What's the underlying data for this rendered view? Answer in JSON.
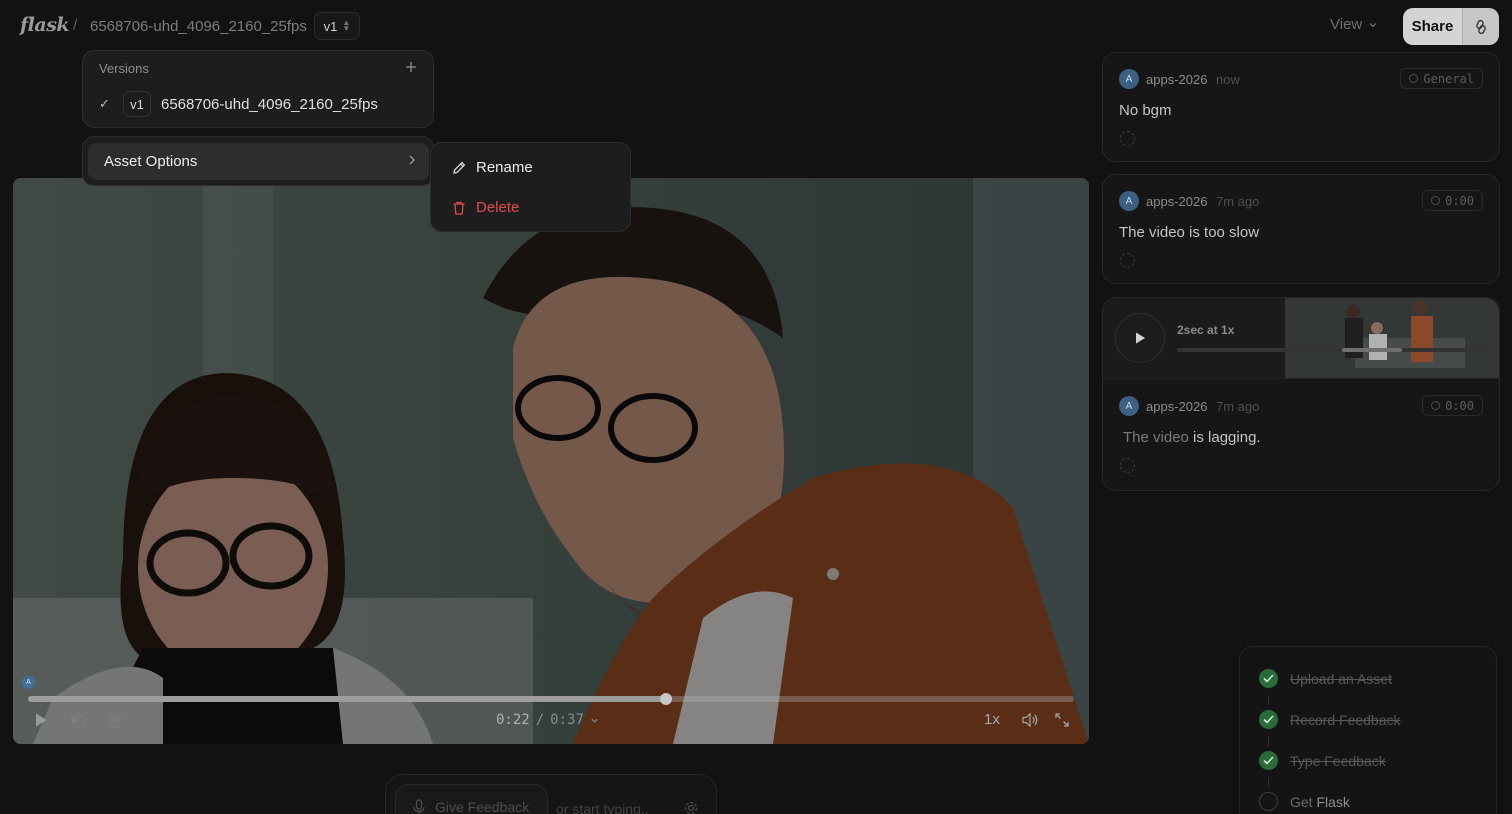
{
  "header": {
    "logo": "flask",
    "separator": "/",
    "asset_name": "6568706-uhd_4096_2160_25fps",
    "version_label": "v1",
    "view_label": "View",
    "share_label": "Share"
  },
  "versions_popover": {
    "title": "Versions",
    "items": [
      {
        "version": "v1",
        "name": "6568706-uhd_4096_2160_25fps",
        "selected": true
      }
    ]
  },
  "asset_menu": {
    "label": "Asset Options",
    "submenu": {
      "rename": "Rename",
      "delete": "Delete"
    }
  },
  "player": {
    "marker_avatar": "A",
    "progress": 0.61,
    "current_time": "0:22",
    "time_separator": "/",
    "duration": "0:37",
    "speed": "1x",
    "skip_back": "10",
    "skip_forward": "10"
  },
  "comments": [
    {
      "avatar": "A",
      "user": "apps-2026",
      "time": "now",
      "badge": "General",
      "text": "No bgm"
    },
    {
      "avatar": "A",
      "user": "apps-2026",
      "time": "7m ago",
      "badge": "0:00",
      "text": "The video is too slow"
    },
    {
      "avatar": "A",
      "user": "apps-2026",
      "time": "7m ago",
      "badge": "0:00",
      "text_pre": "The video",
      "text_post": " is lagging.",
      "recording": {
        "label": "2sec at 1x"
      }
    }
  ],
  "onboarding": {
    "steps": [
      {
        "label": "Upload an Asset",
        "done": true
      },
      {
        "label": "Record Feedback",
        "done": true
      },
      {
        "label": "Type Feedback",
        "done": true
      },
      {
        "label_pre": "Get ",
        "label_bold": "Flask",
        "done": false
      }
    ]
  },
  "composer": {
    "give_feedback": "Give Feedback",
    "placeholder": "or start typing.."
  },
  "colors": {
    "accent_green": "#2a6b3a",
    "danger": "#e5484d",
    "avatar_blue": "#3c5f82"
  }
}
